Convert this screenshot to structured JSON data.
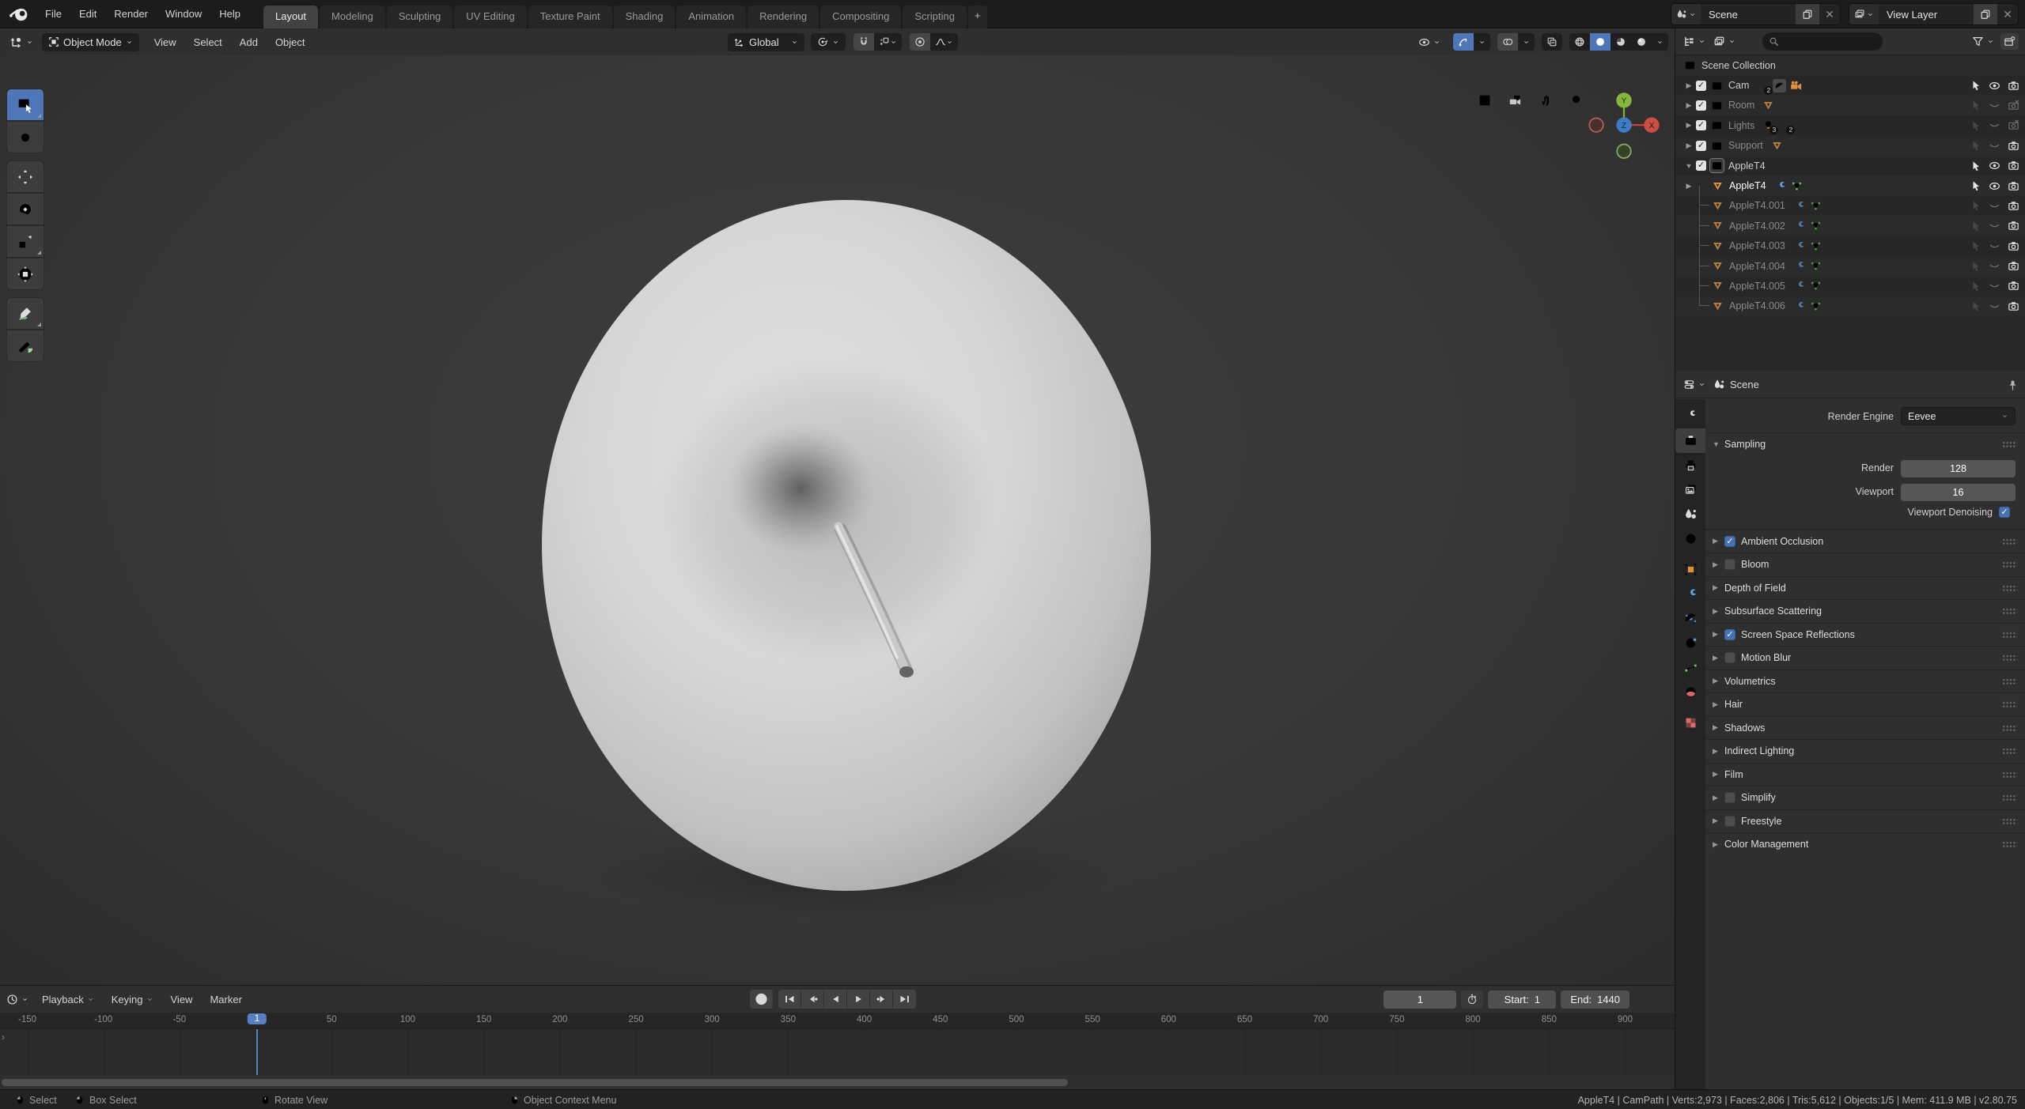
{
  "colors": {
    "accent": "#5680c2",
    "checkbox_blue": "#4772b3",
    "mesh_orange": "#e0913d",
    "wrench_blue": "#5d9fe0",
    "mesh_green": "#6ecb58",
    "data_red": "#d86a6a"
  },
  "topbar": {
    "menus": [
      "File",
      "Edit",
      "Render",
      "Window",
      "Help"
    ],
    "tabs": [
      {
        "label": "Layout",
        "active": true
      },
      {
        "label": "Modeling"
      },
      {
        "label": "Sculpting"
      },
      {
        "label": "UV Editing"
      },
      {
        "label": "Texture Paint"
      },
      {
        "label": "Shading"
      },
      {
        "label": "Animation"
      },
      {
        "label": "Rendering"
      },
      {
        "label": "Compositing"
      },
      {
        "label": "Scripting"
      },
      {
        "label": "+",
        "add": true
      }
    ],
    "scene_selector": {
      "label": "Scene"
    },
    "view_layer_selector": {
      "label": "View Layer"
    }
  },
  "viewport": {
    "mode": "Object Mode",
    "menus": [
      "View",
      "Select",
      "Add",
      "Object"
    ],
    "orientation": "Global",
    "toolbar": [
      {
        "icon": "t-select",
        "name": "select-box-tool",
        "active": true,
        "sub": true
      },
      {
        "icon": "t-cursor",
        "name": "cursor-tool",
        "gend": true
      },
      {
        "icon": "t-move",
        "name": "move-tool",
        "gstart": true
      },
      {
        "icon": "t-rotate",
        "name": "rotate-tool"
      },
      {
        "icon": "t-scale",
        "name": "scale-tool",
        "sub": true
      },
      {
        "icon": "t-transform",
        "name": "transform-tool",
        "gend": true
      },
      {
        "icon": "t-annotate",
        "name": "annotate-tool",
        "gstart": true,
        "sub": true
      },
      {
        "icon": "t-measure",
        "name": "measure-tool",
        "gend": true
      }
    ],
    "nav_icons": [
      {
        "icon": "grid",
        "name": "toggle-grid"
      },
      {
        "icon": "campair",
        "name": "camera-view"
      },
      {
        "icon": "hand",
        "name": "pan-view"
      },
      {
        "icon": "search",
        "name": "zoom-view"
      }
    ],
    "gizmo_axes": {
      "x": "X",
      "y": "Y",
      "z": "Z"
    }
  },
  "outliner": {
    "scene_collection": "Scene Collection",
    "rows": [
      {
        "label": "Scene Collection",
        "icon": "coll",
        "level": 0
      },
      {
        "label": "Cam",
        "icon": "coll",
        "level": 1,
        "disc": "r",
        "check": true,
        "bright": true,
        "extras": [
          {
            "icon": "axes",
            "badge": "2"
          },
          {
            "icon": "curveo",
            "boxed": true
          },
          {
            "icon": "movcam"
          }
        ],
        "sel": "on",
        "eye": "on",
        "cam": "on"
      },
      {
        "label": "Room",
        "icon": "coll",
        "level": 1,
        "disc": "r",
        "check": true,
        "dim": true,
        "extras": [
          {
            "icon": "meshtri"
          }
        ],
        "sel": "off",
        "eye": "off",
        "cam": "x"
      },
      {
        "label": "Lights",
        "icon": "coll",
        "level": 1,
        "disc": "r",
        "check": true,
        "dim": true,
        "extras": [
          {
            "icon": "bulb",
            "badge": "3"
          },
          {
            "icon": "sparks",
            "badge": "2"
          }
        ],
        "sel": "off",
        "eye": "off",
        "cam": "x"
      },
      {
        "label": "Support",
        "icon": "coll",
        "level": 1,
        "disc": "r",
        "check": true,
        "dim": true,
        "extras": [
          {
            "icon": "meshtri"
          }
        ],
        "sel": "off",
        "eye": "off",
        "cam": "on"
      },
      {
        "label": "AppleT4",
        "icon": "coll",
        "level": 1,
        "disc": "d",
        "check": true,
        "active": true,
        "bright": true,
        "extras": [],
        "sel": "on",
        "eye": "on",
        "cam": "on"
      },
      {
        "label": "AppleT4",
        "icon": "meshtri",
        "level": 2,
        "disc": "r",
        "selected": true,
        "bright": true,
        "extras": [
          {
            "icon": "wrench"
          },
          {
            "icon": "meshdata"
          }
        ],
        "sel": "on",
        "eye": "on",
        "cam": "on"
      },
      {
        "label": "AppleT4.001",
        "icon": "meshtri",
        "level": 2,
        "tree": true,
        "dim": true,
        "extras": [
          {
            "icon": "wrench"
          },
          {
            "icon": "meshdata"
          }
        ],
        "sel": "off",
        "eye": "off",
        "cam": "on"
      },
      {
        "label": "AppleT4.002",
        "icon": "meshtri",
        "level": 2,
        "tree": true,
        "dim": true,
        "extras": [
          {
            "icon": "wrench"
          },
          {
            "icon": "meshdata"
          }
        ],
        "sel": "off",
        "eye": "off",
        "cam": "on"
      },
      {
        "label": "AppleT4.003",
        "icon": "meshtri",
        "level": 2,
        "tree": true,
        "dim": true,
        "extras": [
          {
            "icon": "wrench"
          },
          {
            "icon": "meshdata"
          }
        ],
        "sel": "off",
        "eye": "off",
        "cam": "on"
      },
      {
        "label": "AppleT4.004",
        "icon": "meshtri",
        "level": 2,
        "tree": true,
        "dim": true,
        "extras": [
          {
            "icon": "wrench"
          },
          {
            "icon": "meshdata"
          }
        ],
        "sel": "off",
        "eye": "off",
        "cam": "on"
      },
      {
        "label": "AppleT4.005",
        "icon": "meshtri",
        "level": 2,
        "tree": true,
        "dim": true,
        "extras": [
          {
            "icon": "wrench"
          },
          {
            "icon": "meshdata"
          }
        ],
        "sel": "off",
        "eye": "off",
        "cam": "on"
      },
      {
        "label": "AppleT4.006",
        "icon": "meshtri",
        "level": 2,
        "tree": true,
        "dim": true,
        "extras": [
          {
            "icon": "wrench"
          },
          {
            "icon": "meshdata"
          }
        ],
        "sel": "off",
        "eye": "off",
        "cam": "on"
      }
    ]
  },
  "properties": {
    "breadcrumb": "Scene",
    "render_engine_label": "Render Engine",
    "render_engine": "Eevee",
    "sampling": {
      "title": "Sampling",
      "render_label": "Render",
      "render": "128",
      "viewport_label": "Viewport",
      "viewport": "16",
      "denoise_label": "Viewport Denoising",
      "denoise_checked": "✓"
    },
    "tabs": [
      {
        "icon": "toolws",
        "name": "tool",
        "color": "#d9d9d9"
      },
      {
        "icon": "camtab",
        "name": "render",
        "active": true,
        "color": "#e8e8e8"
      },
      {
        "icon": "printer",
        "name": "output",
        "color": "#d9d9d9"
      },
      {
        "icon": "imgs",
        "name": "view-layer",
        "color": "#d9d9d9"
      },
      {
        "icon": "droplet",
        "name": "scene",
        "color": "#d9d9d9"
      },
      {
        "icon": "globe",
        "name": "world",
        "color": "#d86a6a"
      },
      {
        "icon": "objsq",
        "name": "object",
        "color": "#e0913d",
        "gap": true
      },
      {
        "icon": "wrench",
        "name": "modifiers",
        "color": "#5d9fe0"
      },
      {
        "icon": "orbitp",
        "name": "particles",
        "color": "#5d9fe0"
      },
      {
        "icon": "physx",
        "name": "physics",
        "color": "#5d9fe0"
      },
      {
        "icon": "curveg",
        "name": "object-data",
        "color": "#6ecb58"
      },
      {
        "icon": "matball",
        "name": "material",
        "color": "#d86a6a"
      },
      {
        "icon": "checker",
        "name": "texture",
        "color": "#d86a6a",
        "gap": true
      }
    ],
    "panels": [
      {
        "label": "Ambient Occlusion",
        "check": true,
        "checked": true
      },
      {
        "label": "Bloom",
        "check": true,
        "checked": false
      },
      {
        "label": "Depth of Field"
      },
      {
        "label": "Subsurface Scattering"
      },
      {
        "label": "Screen Space Reflections",
        "check": true,
        "checked": true
      },
      {
        "label": "Motion Blur",
        "check": true,
        "checked": false
      },
      {
        "label": "Volumetrics"
      },
      {
        "label": "Hair"
      },
      {
        "label": "Shadows"
      },
      {
        "label": "Indirect Lighting"
      },
      {
        "label": "Film"
      },
      {
        "label": "Simplify",
        "check": true,
        "checked": false
      },
      {
        "label": "Freestyle",
        "check": true,
        "checked": false
      },
      {
        "label": "Color Management"
      }
    ]
  },
  "timeline": {
    "menus": [
      {
        "label": "Playback",
        "chev": true
      },
      {
        "label": "Keying",
        "chev": true
      },
      {
        "label": "View"
      },
      {
        "label": "Marker"
      }
    ],
    "frame": "1",
    "start_label": "Start:",
    "start": "1",
    "end_label": "End:",
    "end": "1440",
    "ruler_ticks": [
      -150,
      -100,
      -50,
      50,
      100,
      150,
      200,
      250,
      300,
      350,
      400,
      450,
      500,
      550,
      600,
      650,
      700,
      750,
      800,
      850,
      900
    ],
    "playhead_frame": "1"
  },
  "statusbar": {
    "left": [
      {
        "icon": "m-left",
        "label": "Select"
      },
      {
        "icon": "m-ldrag",
        "label": "Box Select"
      },
      {
        "icon": "m-mid",
        "label": "Rotate View"
      },
      {
        "icon": "m-right",
        "label": "Object Context Menu"
      }
    ],
    "right": "AppleT4 | CamPath | Verts:2,973 | Faces:2,806 | Tris:5,612 | Objects:1/5 | Mem: 411.9 MB | v2.80.75"
  }
}
